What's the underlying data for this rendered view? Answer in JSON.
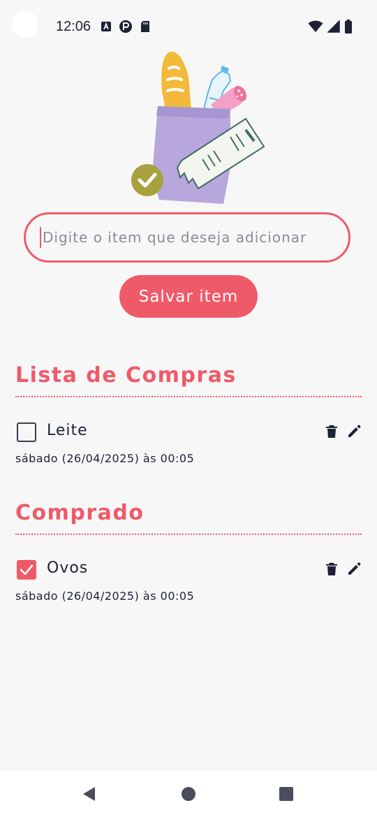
{
  "status_bar": {
    "time": "12:06",
    "left_icons": [
      "font-a-icon",
      "pocket-icon",
      "sd-card-icon"
    ],
    "right_icons": [
      "wifi-icon",
      "signal-icon",
      "battery-icon"
    ]
  },
  "hero": {
    "image": "grocery-bag-illustration"
  },
  "form": {
    "input_value": "",
    "input_placeholder": "Digite o item que deseja adicionar",
    "save_label": "Salvar item"
  },
  "sections": {
    "shopping": {
      "title": "Lista de Compras",
      "items": [
        {
          "name": "Leite",
          "date": "sábado (26/04/2025) às 00:05",
          "checked": false
        }
      ]
    },
    "bought": {
      "title": "Comprado",
      "items": [
        {
          "name": "Ovos",
          "date": "sábado (26/04/2025) às 00:05",
          "checked": true
        }
      ]
    }
  },
  "nav": {
    "buttons": [
      "back-icon",
      "home-icon",
      "recents-icon"
    ]
  },
  "colors": {
    "accent": "#ef5a68",
    "text": "#1e2235",
    "background": "#f7f7f8"
  }
}
